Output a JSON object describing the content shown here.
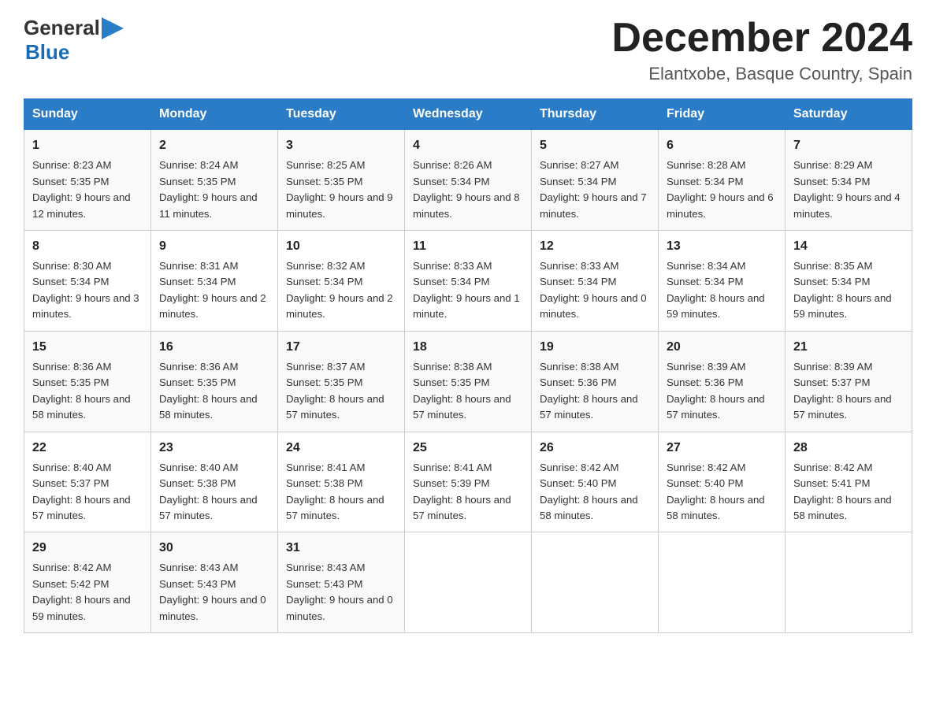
{
  "header": {
    "logo_general": "General",
    "logo_blue": "Blue",
    "month": "December 2024",
    "location": "Elantxobe, Basque Country, Spain"
  },
  "days_of_week": [
    "Sunday",
    "Monday",
    "Tuesday",
    "Wednesday",
    "Thursday",
    "Friday",
    "Saturday"
  ],
  "weeks": [
    [
      {
        "day": "1",
        "sunrise": "8:23 AM",
        "sunset": "5:35 PM",
        "daylight": "9 hours and 12 minutes."
      },
      {
        "day": "2",
        "sunrise": "8:24 AM",
        "sunset": "5:35 PM",
        "daylight": "9 hours and 11 minutes."
      },
      {
        "day": "3",
        "sunrise": "8:25 AM",
        "sunset": "5:35 PM",
        "daylight": "9 hours and 9 minutes."
      },
      {
        "day": "4",
        "sunrise": "8:26 AM",
        "sunset": "5:34 PM",
        "daylight": "9 hours and 8 minutes."
      },
      {
        "day": "5",
        "sunrise": "8:27 AM",
        "sunset": "5:34 PM",
        "daylight": "9 hours and 7 minutes."
      },
      {
        "day": "6",
        "sunrise": "8:28 AM",
        "sunset": "5:34 PM",
        "daylight": "9 hours and 6 minutes."
      },
      {
        "day": "7",
        "sunrise": "8:29 AM",
        "sunset": "5:34 PM",
        "daylight": "9 hours and 4 minutes."
      }
    ],
    [
      {
        "day": "8",
        "sunrise": "8:30 AM",
        "sunset": "5:34 PM",
        "daylight": "9 hours and 3 minutes."
      },
      {
        "day": "9",
        "sunrise": "8:31 AM",
        "sunset": "5:34 PM",
        "daylight": "9 hours and 2 minutes."
      },
      {
        "day": "10",
        "sunrise": "8:32 AM",
        "sunset": "5:34 PM",
        "daylight": "9 hours and 2 minutes."
      },
      {
        "day": "11",
        "sunrise": "8:33 AM",
        "sunset": "5:34 PM",
        "daylight": "9 hours and 1 minute."
      },
      {
        "day": "12",
        "sunrise": "8:33 AM",
        "sunset": "5:34 PM",
        "daylight": "9 hours and 0 minutes."
      },
      {
        "day": "13",
        "sunrise": "8:34 AM",
        "sunset": "5:34 PM",
        "daylight": "8 hours and 59 minutes."
      },
      {
        "day": "14",
        "sunrise": "8:35 AM",
        "sunset": "5:34 PM",
        "daylight": "8 hours and 59 minutes."
      }
    ],
    [
      {
        "day": "15",
        "sunrise": "8:36 AM",
        "sunset": "5:35 PM",
        "daylight": "8 hours and 58 minutes."
      },
      {
        "day": "16",
        "sunrise": "8:36 AM",
        "sunset": "5:35 PM",
        "daylight": "8 hours and 58 minutes."
      },
      {
        "day": "17",
        "sunrise": "8:37 AM",
        "sunset": "5:35 PM",
        "daylight": "8 hours and 57 minutes."
      },
      {
        "day": "18",
        "sunrise": "8:38 AM",
        "sunset": "5:35 PM",
        "daylight": "8 hours and 57 minutes."
      },
      {
        "day": "19",
        "sunrise": "8:38 AM",
        "sunset": "5:36 PM",
        "daylight": "8 hours and 57 minutes."
      },
      {
        "day": "20",
        "sunrise": "8:39 AM",
        "sunset": "5:36 PM",
        "daylight": "8 hours and 57 minutes."
      },
      {
        "day": "21",
        "sunrise": "8:39 AM",
        "sunset": "5:37 PM",
        "daylight": "8 hours and 57 minutes."
      }
    ],
    [
      {
        "day": "22",
        "sunrise": "8:40 AM",
        "sunset": "5:37 PM",
        "daylight": "8 hours and 57 minutes."
      },
      {
        "day": "23",
        "sunrise": "8:40 AM",
        "sunset": "5:38 PM",
        "daylight": "8 hours and 57 minutes."
      },
      {
        "day": "24",
        "sunrise": "8:41 AM",
        "sunset": "5:38 PM",
        "daylight": "8 hours and 57 minutes."
      },
      {
        "day": "25",
        "sunrise": "8:41 AM",
        "sunset": "5:39 PM",
        "daylight": "8 hours and 57 minutes."
      },
      {
        "day": "26",
        "sunrise": "8:42 AM",
        "sunset": "5:40 PM",
        "daylight": "8 hours and 58 minutes."
      },
      {
        "day": "27",
        "sunrise": "8:42 AM",
        "sunset": "5:40 PM",
        "daylight": "8 hours and 58 minutes."
      },
      {
        "day": "28",
        "sunrise": "8:42 AM",
        "sunset": "5:41 PM",
        "daylight": "8 hours and 58 minutes."
      }
    ],
    [
      {
        "day": "29",
        "sunrise": "8:42 AM",
        "sunset": "5:42 PM",
        "daylight": "8 hours and 59 minutes."
      },
      {
        "day": "30",
        "sunrise": "8:43 AM",
        "sunset": "5:43 PM",
        "daylight": "9 hours and 0 minutes."
      },
      {
        "day": "31",
        "sunrise": "8:43 AM",
        "sunset": "5:43 PM",
        "daylight": "9 hours and 0 minutes."
      },
      null,
      null,
      null,
      null
    ]
  ],
  "labels": {
    "sunrise": "Sunrise:",
    "sunset": "Sunset:",
    "daylight": "Daylight:"
  }
}
